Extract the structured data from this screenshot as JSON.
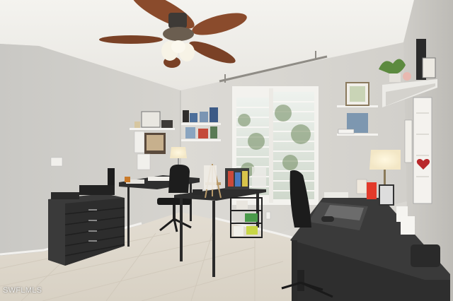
{
  "watermark": "SWFLMLS"
}
